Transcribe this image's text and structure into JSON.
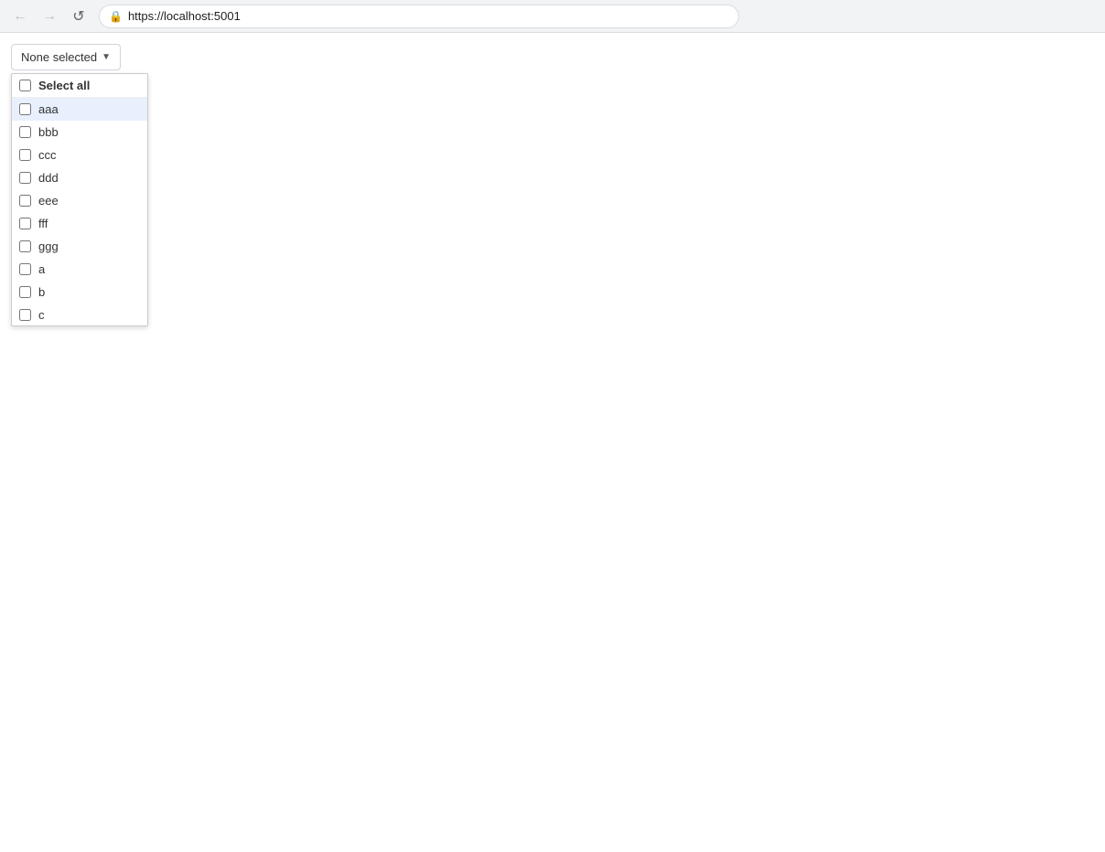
{
  "browser": {
    "url": "https://localhost:5001",
    "back_label": "←",
    "forward_label": "→",
    "reload_label": "↺"
  },
  "dropdown": {
    "button_label": "None selected",
    "arrow": "▼",
    "select_all_label": "Select all",
    "items": [
      {
        "id": "aaa",
        "label": "aaa",
        "checked": false,
        "highlighted": true
      },
      {
        "id": "bbb",
        "label": "bbb",
        "checked": false,
        "highlighted": false
      },
      {
        "id": "ccc",
        "label": "ccc",
        "checked": false,
        "highlighted": false
      },
      {
        "id": "ddd",
        "label": "ddd",
        "checked": false,
        "highlighted": false
      },
      {
        "id": "eee",
        "label": "eee",
        "checked": false,
        "highlighted": false
      },
      {
        "id": "fff",
        "label": "fff",
        "checked": false,
        "highlighted": false
      },
      {
        "id": "ggg",
        "label": "ggg",
        "checked": false,
        "highlighted": false
      },
      {
        "id": "a",
        "label": "a",
        "checked": false,
        "highlighted": false
      },
      {
        "id": "b",
        "label": "b",
        "checked": false,
        "highlighted": false
      },
      {
        "id": "c",
        "label": "c",
        "checked": false,
        "highlighted": false
      }
    ]
  }
}
